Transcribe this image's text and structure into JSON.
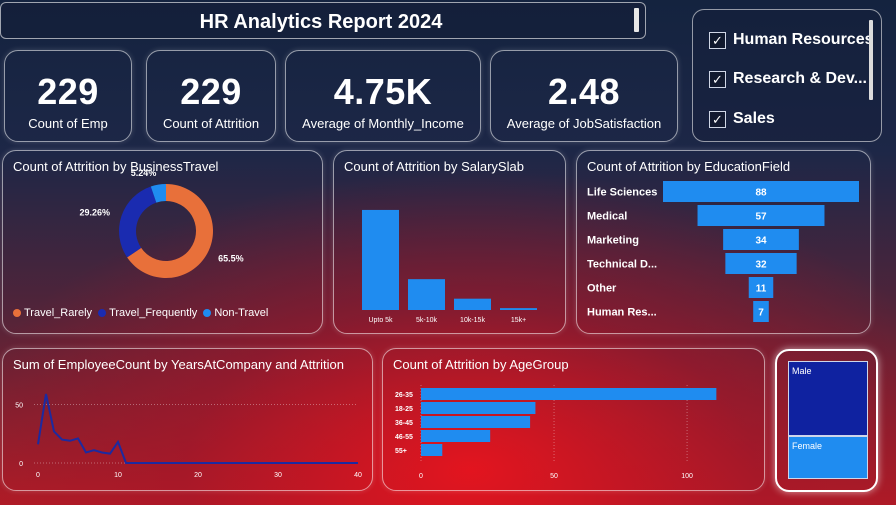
{
  "header": {
    "title": "HR Analytics Report 2024"
  },
  "kpis": [
    {
      "value": "229",
      "label": "Count of Emp"
    },
    {
      "value": "229",
      "label": "Count of Attrition"
    },
    {
      "value": "4.75K",
      "label": "Average of Monthly_Income"
    },
    {
      "value": "2.48",
      "label": "Average of JobSatisfaction"
    }
  ],
  "slicer": {
    "items": [
      {
        "label": "Human Resources",
        "checked": true
      },
      {
        "label": "Research & Dev...",
        "checked": true
      },
      {
        "label": "Sales",
        "checked": true
      }
    ],
    "check_glyph": "✓"
  },
  "colors": {
    "blue": "#1f8cf0",
    "orange": "#e8703a",
    "navy": "#1a2bb0",
    "light_blue": "#2f8ff0",
    "line": "#1c2aa0"
  },
  "chart_data": [
    {
      "type": "pie",
      "title": "Count of Attrition by BusinessTravel",
      "donut": true,
      "slices": [
        {
          "name": "Travel_Rarely",
          "value": 65.5,
          "label": "65.5%",
          "color": "#e8703a"
        },
        {
          "name": "Travel_Frequently",
          "value": 29.26,
          "label": "29.26%",
          "color": "#1a2bb0"
        },
        {
          "name": "Non-Travel",
          "value": 5.24,
          "label": "5.24%",
          "color": "#1f8cf0"
        }
      ],
      "legend_position": "bottom"
    },
    {
      "type": "bar",
      "title": "Count of Attrition by SalarySlab",
      "categories": [
        "Upto 5k",
        "5k-10k",
        "10k-15k",
        "15k+"
      ],
      "values": [
        159,
        49,
        18,
        3
      ],
      "ylim": [
        0,
        170
      ],
      "grid": false
    },
    {
      "type": "bar",
      "orientation": "horizontal-funnel",
      "title": "Count of Attrition by EducationField",
      "categories": [
        "Life Sciences",
        "Medical",
        "Marketing",
        "Technical D...",
        "Other",
        "Human Res..."
      ],
      "values": [
        88,
        57,
        34,
        32,
        11,
        7
      ],
      "value_labels": [
        "88",
        "57",
        "34",
        "32",
        "11",
        "7"
      ]
    },
    {
      "type": "line",
      "title": "Sum of EmployeeCount by YearsAtCompany and Attrition",
      "x": [
        0,
        1,
        2,
        3,
        4,
        5,
        6,
        7,
        8,
        9,
        10,
        11,
        12,
        13,
        14,
        15,
        16,
        17,
        18,
        19,
        20,
        21,
        22,
        23,
        24,
        25,
        26,
        27,
        28,
        29,
        30,
        31,
        32,
        33,
        34,
        35,
        36,
        37,
        38,
        39,
        40
      ],
      "y": [
        16,
        59,
        27,
        20,
        19,
        21,
        9,
        11,
        9,
        8,
        18,
        0,
        0,
        0,
        0,
        0,
        0,
        0,
        0,
        0,
        0,
        0,
        0,
        0,
        0,
        0,
        0,
        0,
        0,
        0,
        0,
        0,
        0,
        0,
        0,
        0,
        0,
        0,
        0,
        0,
        0
      ],
      "xticks": [
        "0",
        "10",
        "20",
        "30",
        "40"
      ],
      "yticks": [
        "0",
        "50"
      ],
      "xlim": [
        0,
        40
      ],
      "ylim": [
        0,
        65
      ],
      "grid": true
    },
    {
      "type": "bar",
      "orientation": "horizontal",
      "title": "Count of Attrition by AgeGroup",
      "categories": [
        "26-35",
        "18-25",
        "36-45",
        "46-55",
        "55+"
      ],
      "values": [
        111,
        43,
        41,
        26,
        8
      ],
      "xticks": [
        "0",
        "50",
        "100"
      ],
      "xlim": [
        0,
        115
      ],
      "grid": true
    },
    {
      "type": "heatmap",
      "title": "",
      "categories": [
        "Male",
        "Female"
      ],
      "values": [
        140,
        89
      ],
      "colors": [
        "#0f22a0",
        "#1f8cf0"
      ]
    }
  ]
}
